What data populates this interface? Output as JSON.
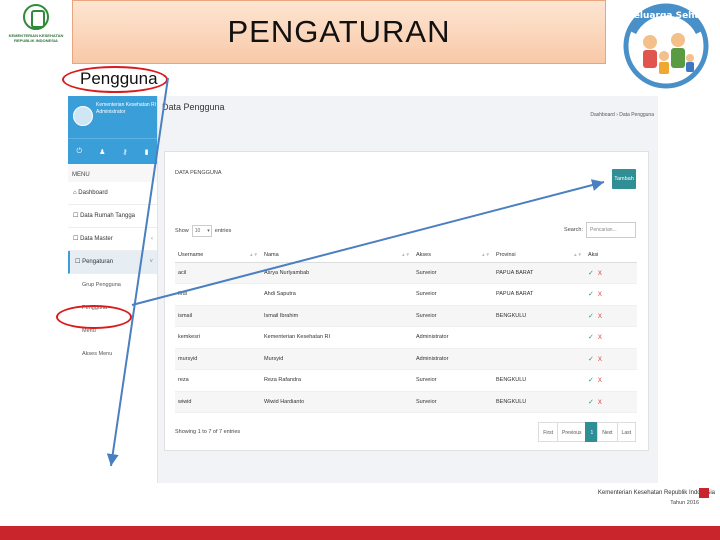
{
  "slide": {
    "title": "PENGATURAN",
    "annotation_label": "Pengguna :",
    "kemkes_logo_text": "KEMENTERIAN KESEHATAN REPUBLIK INDONESIA",
    "keluarga_logo_text": "Keluarga Sehat",
    "footer_org": "Kementerian Kesehatan Republik Indonesia",
    "footer_year": "Tahun 2016",
    "annotation_color": "#d91b1b",
    "arrow_color": "#4a7fc1"
  },
  "app": {
    "profile": {
      "org": "Kementerian Kesehatan RI",
      "role": "Administrator"
    },
    "quick_icons": [
      "power-icon",
      "user-icon",
      "key-icon",
      "lock-icon"
    ],
    "menu_heading": "MENU",
    "menu": [
      {
        "label": "Dashboard",
        "icon": "home-icon"
      },
      {
        "label": "Data Rumah Tangga",
        "icon": "square-icon"
      },
      {
        "label": "Data Master",
        "icon": "square-icon",
        "chevron": "‹"
      },
      {
        "label": "Pengaturan",
        "icon": "square-icon",
        "chevron": "˅",
        "active": true
      }
    ],
    "submenu": [
      "Grup Pengguna",
      "Pengguna",
      "Menu",
      "Akses Menu"
    ],
    "page_title": "Data Pengguna",
    "breadcrumb": "Dashboard › Data Pengguna",
    "panel_title": "DATA PENGGUNA",
    "add_button": "Tambah",
    "show_label": "Show",
    "show_value": "10",
    "entries_label": "entries",
    "search_label": "Search:",
    "search_placeholder": "Pencarian...",
    "table": {
      "headers": [
        "Username",
        "Nama",
        "Akses",
        "Provinsi",
        "Aksi"
      ],
      "rows": [
        [
          "acil",
          "Asrya Nurlyambab",
          "Surveior",
          "PAPUA BARAT",
          "",
          ""
        ],
        [
          "firdi",
          "Ahdi Saputra",
          "Surveior",
          "PAPUA BARAT",
          "",
          ""
        ],
        [
          "ismail",
          "Ismail Ibrahim",
          "Surveior",
          "BENGKULU",
          "",
          ""
        ],
        [
          "kemkesri",
          "Kementerian Kesehatan RI",
          "Administrator",
          "",
          "",
          ""
        ],
        [
          "mursyid",
          "Mursyid",
          "Administrator",
          "",
          "",
          ""
        ],
        [
          "reza",
          "Reza Rafandra",
          "Surveior",
          "BENGKULU",
          "",
          ""
        ],
        [
          "wiwid",
          "Wiwid Hardianto",
          "Surveior",
          "BENGKULU",
          "",
          ""
        ]
      ],
      "edit_glyph": "✓",
      "delete_glyph": "X"
    },
    "info_text": "Showing 1 to 7 of 7 entries",
    "pager": [
      "First",
      "Previous",
      "1",
      "Next",
      "Last"
    ]
  }
}
